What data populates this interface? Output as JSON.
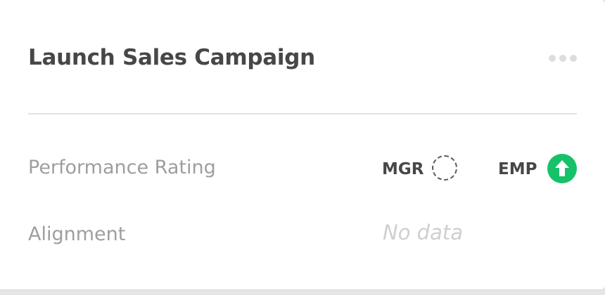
{
  "card": {
    "title": "Launch Sales Campaign",
    "menu_icon": "more-horizontal-icon"
  },
  "performance": {
    "label": "Performance Rating",
    "mgr_label": "MGR",
    "mgr_status": "empty-dashed-circle",
    "emp_label": "EMP",
    "emp_status": "arrow-up-circle",
    "emp_color": "#17c16a"
  },
  "alignment": {
    "label": "Alignment",
    "value": "No data"
  }
}
